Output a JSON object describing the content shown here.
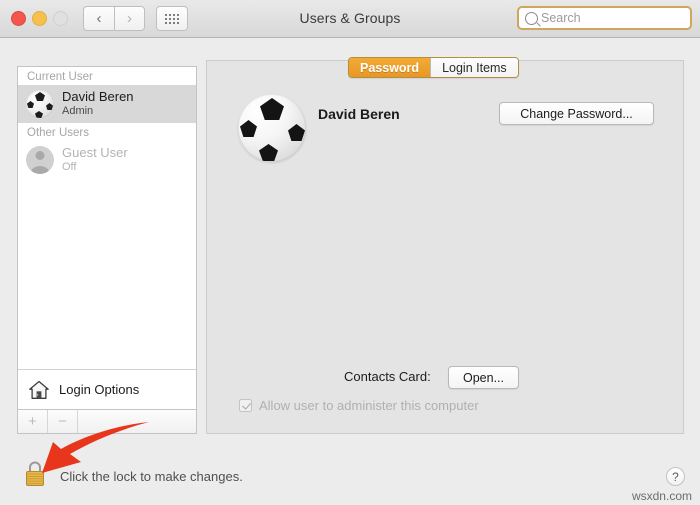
{
  "window": {
    "title": "Users & Groups",
    "traffic_lights": [
      "close",
      "minimize",
      "zoom"
    ],
    "nav": {
      "back_icon": "chevron-left-icon",
      "forward_icon": "chevron-right-icon"
    },
    "show_all_icon": "grid-dots-icon"
  },
  "search": {
    "placeholder": "Search",
    "value": "",
    "icon": "search-icon",
    "focus_ring_color": "#cfa65c"
  },
  "sidebar": {
    "groups": [
      {
        "label": "Current User",
        "users": [
          {
            "name": "David Beren",
            "status": "Admin",
            "avatar": "soccer-ball-avatar",
            "selected": true,
            "enabled": true
          }
        ]
      },
      {
        "label": "Other Users",
        "users": [
          {
            "name": "Guest User",
            "status": "Off",
            "avatar": "person-placeholder-avatar",
            "selected": false,
            "enabled": false
          }
        ]
      }
    ],
    "login_options": {
      "label": "Login Options",
      "icon": "home-icon"
    },
    "toolbar": {
      "add_label": "+",
      "remove_label": "−",
      "add_icon": "plus-icon",
      "remove_icon": "minus-icon",
      "enabled": false
    }
  },
  "tabs": [
    {
      "label": "Password",
      "active": true
    },
    {
      "label": "Login Items",
      "active": false
    }
  ],
  "main": {
    "account_avatar": "soccer-ball-avatar",
    "account_name": "David Beren",
    "change_password_label": "Change Password...",
    "contacts_card_label": "Contacts Card:",
    "contacts_open_label": "Open...",
    "admin_checkbox": {
      "label": "Allow user to administer this computer",
      "checked": true,
      "enabled": false
    }
  },
  "footer": {
    "lock_icon": "lock-closed-icon",
    "lock_message": "Click the lock to make changes.",
    "help_label": "?",
    "help_icon": "question-mark-icon"
  },
  "annotation": {
    "arrow_icon": "red-arrow-icon",
    "arrow_color": "#e8361c",
    "points_to": "lock-icon"
  },
  "watermark": "wsxdn.com",
  "colors": {
    "window_background": "#ececec",
    "panel_background": "#e4e4e4",
    "tab_active": "#e89726",
    "selection": "#d8d8d8",
    "lock_gold": "#e8b84b"
  }
}
